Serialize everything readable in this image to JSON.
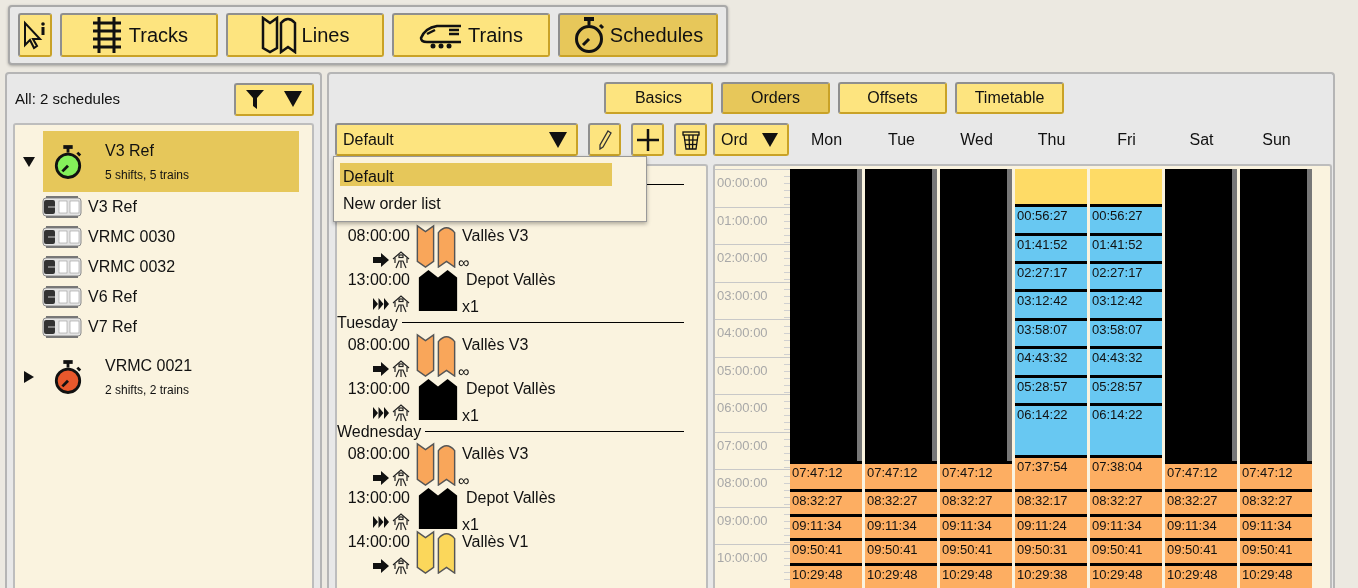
{
  "toolbar": [
    {
      "kind": "select",
      "selected": false
    },
    {
      "kind": "tracks",
      "label": "Tracks",
      "selected": false
    },
    {
      "kind": "lines",
      "label": "Lines",
      "selected": false
    },
    {
      "kind": "trains",
      "label": "Trains",
      "selected": false
    },
    {
      "kind": "schedules",
      "label": "Schedules",
      "selected": true
    }
  ],
  "schedules_panel": {
    "summary": "All: 2 schedules",
    "schedules": [
      {
        "name": "V3 Ref",
        "detail": "5 shifts, 5 trains",
        "color": "#84f05a",
        "expanded": true,
        "selected": true,
        "trains": [
          {
            "name": "V3 Ref"
          },
          {
            "name": "VRMC 0030"
          },
          {
            "name": "VRMC 0032"
          },
          {
            "name": "V6 Ref"
          },
          {
            "name": "V7 Ref"
          }
        ]
      },
      {
        "name": "VRMC 0021",
        "detail": "2 shifts, 2 trains",
        "color": "#e8582c",
        "expanded": false,
        "selected": false
      }
    ]
  },
  "tabs": [
    {
      "label": "Basics",
      "selected": false
    },
    {
      "label": "Orders",
      "selected": true
    },
    {
      "label": "Offsets",
      "selected": false
    },
    {
      "label": "Timetable",
      "selected": false
    }
  ],
  "order_list": {
    "value": "Default",
    "expanded": true,
    "options": [
      {
        "label": "Default",
        "selected": true
      },
      {
        "label": "New order list",
        "selected": false
      }
    ]
  },
  "orders": {
    "groups": [
      {
        "orders": [
          {
            "time": "08:00:00",
            "kind": "line",
            "color": "#f9a65a",
            "name": "Vallès V3",
            "note": "∞"
          },
          {
            "time": "13:00:00",
            "kind": "depot",
            "color": "#000000",
            "name": "Depot Vallès",
            "note": "x1"
          }
        ]
      },
      {
        "day": "Tuesday",
        "orders": [
          {
            "time": "08:00:00",
            "kind": "line",
            "color": "#f9a65a",
            "name": "Vallès V3",
            "note": "∞"
          },
          {
            "time": "13:00:00",
            "kind": "depot",
            "color": "#000000",
            "name": "Depot Vallès",
            "note": "x1"
          }
        ]
      },
      {
        "day": "Wednesday",
        "orders": [
          {
            "time": "08:00:00",
            "kind": "line",
            "color": "#f9a65a",
            "name": "Vallès V3",
            "note": "∞"
          },
          {
            "time": "13:00:00",
            "kind": "depot",
            "color": "#000000",
            "name": "Depot Vallès",
            "note": "x1"
          },
          {
            "time": "14:00:00",
            "kind": "line",
            "color": "#fbd75b",
            "name": "Vallès V1"
          }
        ]
      }
    ]
  },
  "timetable": {
    "mode": "Ord",
    "hours": [
      "00:00:00",
      "01:00:00",
      "02:00:00",
      "03:00:00",
      "04:00:00",
      "05:00:00",
      "06:00:00",
      "07:00:00",
      "08:00:00",
      "09:00:00",
      "10:00:00"
    ],
    "days": [
      {
        "name": "Mon",
        "segments": [
          {
            "kind": "idle"
          },
          {
            "kind": "block",
            "color": "#fdae62",
            "label": "07:47:12"
          },
          {
            "kind": "block",
            "color": "#fdae62",
            "label": "08:32:27"
          },
          {
            "kind": "block",
            "color": "#fdae62",
            "label": "09:11:34"
          },
          {
            "kind": "block",
            "color": "#fdae62",
            "label": "09:50:41"
          },
          {
            "kind": "block",
            "color": "#fdae62",
            "label": "10:29:48"
          }
        ]
      },
      {
        "name": "Tue",
        "segments": [
          {
            "kind": "idle"
          },
          {
            "kind": "block",
            "color": "#fdae62",
            "label": "07:47:12"
          },
          {
            "kind": "block",
            "color": "#fdae62",
            "label": "08:32:27"
          },
          {
            "kind": "block",
            "color": "#fdae62",
            "label": "09:11:34"
          },
          {
            "kind": "block",
            "color": "#fdae62",
            "label": "09:50:41"
          },
          {
            "kind": "block",
            "color": "#fdae62",
            "label": "10:29:48"
          }
        ]
      },
      {
        "name": "Wed",
        "segments": [
          {
            "kind": "idle"
          },
          {
            "kind": "block",
            "color": "#fdae62",
            "label": "07:47:12"
          },
          {
            "kind": "block",
            "color": "#fdae62",
            "label": "08:32:27"
          },
          {
            "kind": "block",
            "color": "#fdae62",
            "label": "09:11:34"
          },
          {
            "kind": "block",
            "color": "#fdae62",
            "label": "09:50:41"
          },
          {
            "kind": "block",
            "color": "#fdae62",
            "label": "10:29:48"
          }
        ]
      },
      {
        "name": "Thu",
        "segments": [
          {
            "kind": "block",
            "color": "#fedb66"
          },
          {
            "kind": "block",
            "color": "#68c8f2",
            "label": "00:56:27"
          },
          {
            "kind": "block",
            "color": "#68c8f2",
            "label": "01:41:52"
          },
          {
            "kind": "block",
            "color": "#68c8f2",
            "label": "02:27:17"
          },
          {
            "kind": "block",
            "color": "#68c8f2",
            "label": "03:12:42"
          },
          {
            "kind": "block",
            "color": "#68c8f2",
            "label": "03:58:07"
          },
          {
            "kind": "block",
            "color": "#68c8f2",
            "label": "04:43:32"
          },
          {
            "kind": "block",
            "color": "#68c8f2",
            "label": "05:28:57"
          },
          {
            "kind": "block",
            "color": "#68c8f2",
            "label": "06:14:22"
          },
          {
            "kind": "block",
            "color": "#fdae62",
            "label": "07:37:54"
          },
          {
            "kind": "block",
            "color": "#fdae62",
            "label": "08:32:17"
          },
          {
            "kind": "block",
            "color": "#fdae62",
            "label": "09:11:24"
          },
          {
            "kind": "block",
            "color": "#fdae62",
            "label": "09:50:31"
          },
          {
            "kind": "block",
            "color": "#fdae62",
            "label": "10:29:38"
          }
        ]
      },
      {
        "name": "Fri",
        "segments": [
          {
            "kind": "block",
            "color": "#fedb66"
          },
          {
            "kind": "block",
            "color": "#68c8f2",
            "label": "00:56:27"
          },
          {
            "kind": "block",
            "color": "#68c8f2",
            "label": "01:41:52"
          },
          {
            "kind": "block",
            "color": "#68c8f2",
            "label": "02:27:17"
          },
          {
            "kind": "block",
            "color": "#68c8f2",
            "label": "03:12:42"
          },
          {
            "kind": "block",
            "color": "#68c8f2",
            "label": "03:58:07"
          },
          {
            "kind": "block",
            "color": "#68c8f2",
            "label": "04:43:32"
          },
          {
            "kind": "block",
            "color": "#68c8f2",
            "label": "05:28:57"
          },
          {
            "kind": "block",
            "color": "#68c8f2",
            "label": "06:14:22"
          },
          {
            "kind": "block",
            "color": "#fdae62",
            "label": "07:38:04"
          },
          {
            "kind": "block",
            "color": "#fdae62",
            "label": "08:32:27"
          },
          {
            "kind": "block",
            "color": "#fdae62",
            "label": "09:11:34"
          },
          {
            "kind": "block",
            "color": "#fdae62",
            "label": "09:50:41"
          },
          {
            "kind": "block",
            "color": "#fdae62",
            "label": "10:29:48"
          }
        ]
      },
      {
        "name": "Sat",
        "segments": [
          {
            "kind": "idle"
          },
          {
            "kind": "block",
            "color": "#fdae62",
            "label": "07:47:12"
          },
          {
            "kind": "block",
            "color": "#fdae62",
            "label": "08:32:27"
          },
          {
            "kind": "block",
            "color": "#fdae62",
            "label": "09:11:34"
          },
          {
            "kind": "block",
            "color": "#fdae62",
            "label": "09:50:41"
          },
          {
            "kind": "block",
            "color": "#fdae62",
            "label": "10:29:48"
          }
        ]
      },
      {
        "name": "Sun",
        "segments": [
          {
            "kind": "idle"
          },
          {
            "kind": "block",
            "color": "#fdae62",
            "label": "07:47:12"
          },
          {
            "kind": "block",
            "color": "#fdae62",
            "label": "08:32:27"
          },
          {
            "kind": "block",
            "color": "#fdae62",
            "label": "09:11:34"
          },
          {
            "kind": "block",
            "color": "#fdae62",
            "label": "09:50:41"
          },
          {
            "kind": "block",
            "color": "#fdae62",
            "label": "10:29:48"
          }
        ]
      }
    ]
  }
}
